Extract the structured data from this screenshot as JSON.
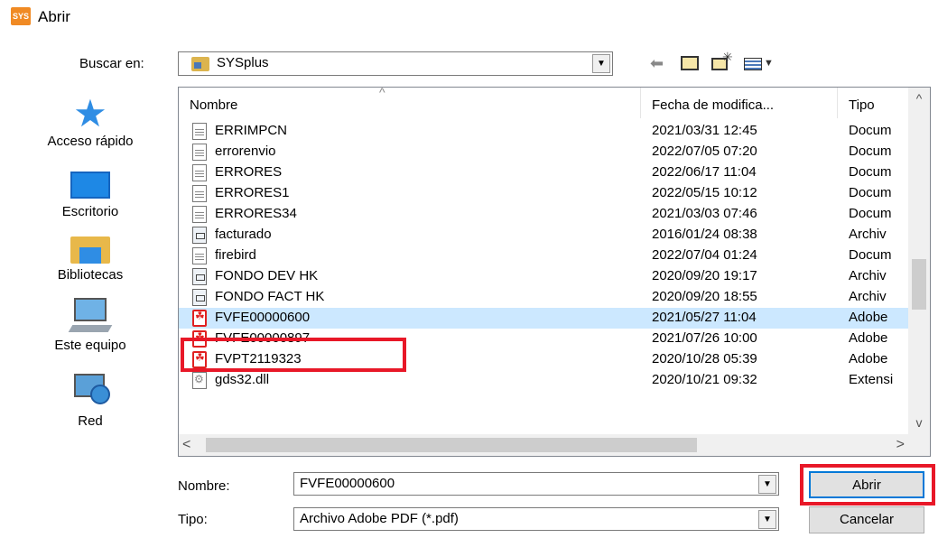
{
  "window": {
    "title": "Abrir",
    "app_icon_text": "SYS"
  },
  "lookin": {
    "label": "Buscar en:",
    "value": "SYSplus"
  },
  "toolbar": {
    "back": "back-arrow-icon",
    "up": "up-folder-icon",
    "new_folder": "new-folder-icon",
    "view": "view-menu-icon"
  },
  "places": [
    {
      "label": "Acceso rápido",
      "icon": "star-icon"
    },
    {
      "label": "Escritorio",
      "icon": "desktop-icon"
    },
    {
      "label": "Bibliotecas",
      "icon": "libraries-icon"
    },
    {
      "label": "Este equipo",
      "icon": "computer-icon"
    },
    {
      "label": "Red",
      "icon": "network-icon"
    }
  ],
  "columns": {
    "name": "Nombre",
    "date": "Fecha de modifica...",
    "type": "Tipo"
  },
  "files": [
    {
      "name": "ERRIMPCN",
      "date": "2021/03/31 12:45",
      "type": "Docum",
      "icon": "doc"
    },
    {
      "name": "errorenvio",
      "date": "2022/07/05 07:20",
      "type": "Docum",
      "icon": "doc"
    },
    {
      "name": "ERRORES",
      "date": "2022/06/17 11:04",
      "type": "Docum",
      "icon": "doc"
    },
    {
      "name": "ERRORES1",
      "date": "2022/05/15 10:12",
      "type": "Docum",
      "icon": "doc"
    },
    {
      "name": "ERRORES34",
      "date": "2021/03/03 07:46",
      "type": "Docum",
      "icon": "doc"
    },
    {
      "name": "facturado",
      "date": "2016/01/24 08:38",
      "type": "Archiv",
      "icon": "arc"
    },
    {
      "name": "firebird",
      "date": "2022/07/04 01:24",
      "type": "Docum",
      "icon": "doc"
    },
    {
      "name": "FONDO DEV HK",
      "date": "2020/09/20 19:17",
      "type": "Archiv",
      "icon": "arc"
    },
    {
      "name": "FONDO FACT HK",
      "date": "2020/09/20 18:55",
      "type": "Archiv",
      "icon": "arc"
    },
    {
      "name": "FVFE00000600",
      "date": "2021/05/27 11:04",
      "type": "Adobe",
      "icon": "pdf",
      "selected": true
    },
    {
      "name": "FVFE00000897",
      "date": "2021/07/26 10:00",
      "type": "Adobe",
      "icon": "pdf"
    },
    {
      "name": "FVPT2119323",
      "date": "2020/10/28 05:39",
      "type": "Adobe",
      "icon": "pdf"
    },
    {
      "name": "gds32.dll",
      "date": "2020/10/21 09:32",
      "type": "Extensi",
      "icon": "dll"
    }
  ],
  "filename": {
    "label": "Nombre:",
    "value": "FVFE00000600"
  },
  "filetype": {
    "label": "Tipo:",
    "value": "Archivo Adobe PDF (*.pdf)"
  },
  "buttons": {
    "open": "Abrir",
    "cancel": "Cancelar"
  },
  "highlight_color": "#e81828"
}
